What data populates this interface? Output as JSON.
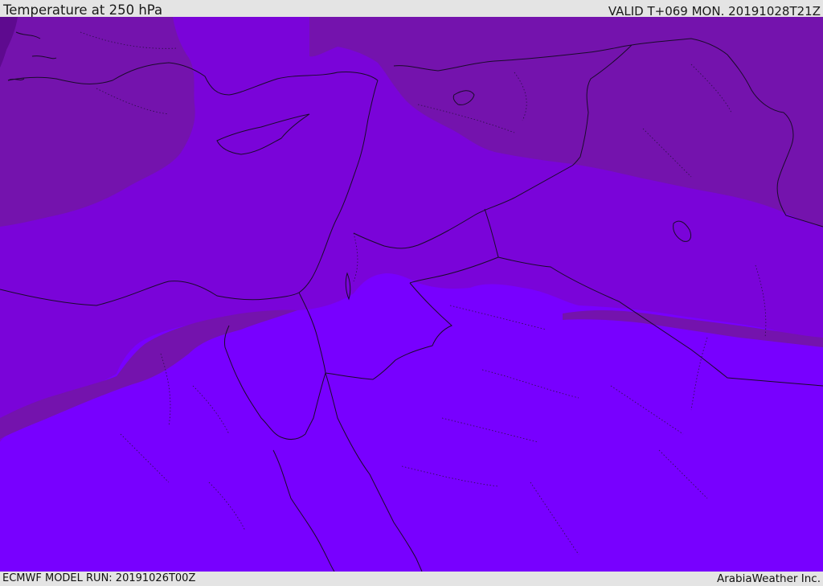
{
  "header": {
    "title": "Temperature at 250 hPa",
    "valid_time": "VALID T+069 MON. 20191028T21Z"
  },
  "footer": {
    "model_run": "ECMWF MODEL RUN: 20191026T00Z",
    "credit": "ArabiaWeather Inc."
  },
  "map": {
    "fill_colors": {
      "coldest_band": "#5e0a8f",
      "cold_band": "#7413ad",
      "mid_band": "#7a04d9",
      "warm_band": "#7800ff"
    },
    "boundary_color": "#1a0b2a"
  }
}
